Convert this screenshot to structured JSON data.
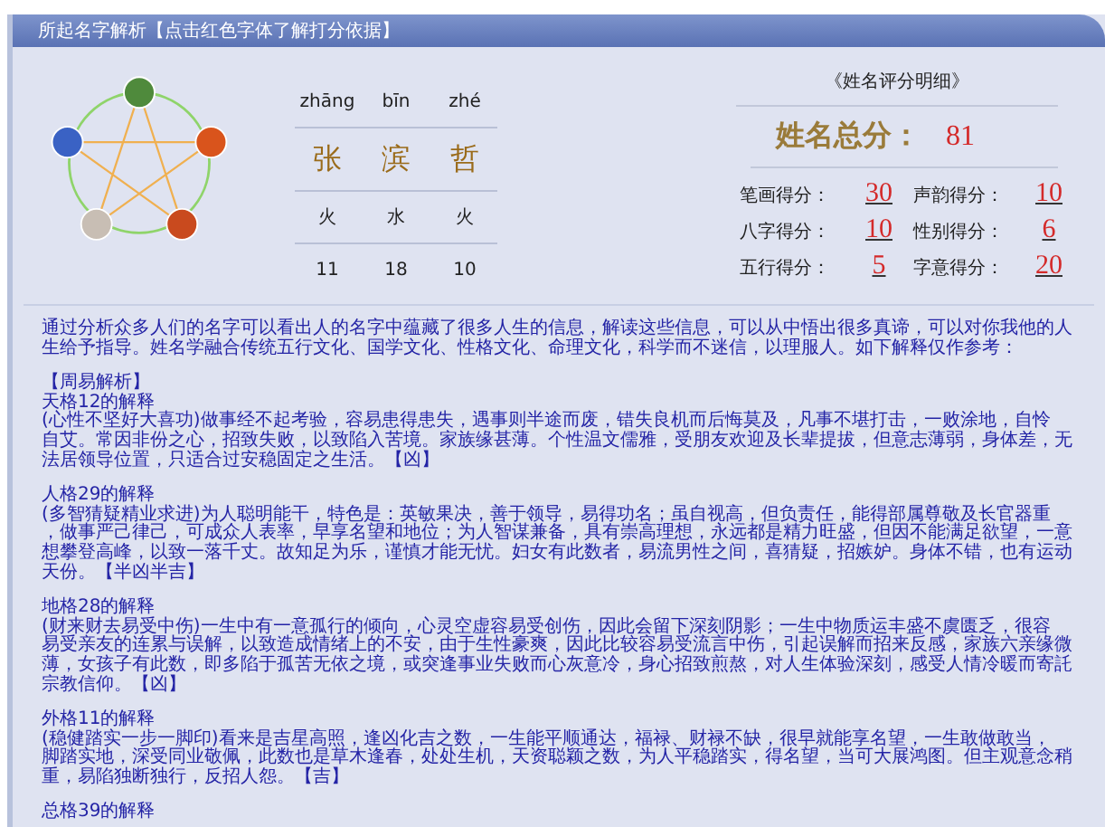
{
  "window": {
    "title": "所起名字解析【点击红色字体了解打分依据】"
  },
  "characters": [
    {
      "pinyin": "zhāng",
      "hanzi": "张",
      "element": "火",
      "strokes": "11"
    },
    {
      "pinyin": "bīn",
      "hanzi": "滨",
      "element": "水",
      "strokes": "18"
    },
    {
      "pinyin": "zhé",
      "hanzi": "哲",
      "element": "火",
      "strokes": "10"
    }
  ],
  "score_panel": {
    "heading": "《姓名评分明细》",
    "total_label": "姓名总分：",
    "total": "81",
    "items": [
      {
        "label": "笔画得分：",
        "value": "30"
      },
      {
        "label": "声韵得分：",
        "value": "10"
      },
      {
        "label": "八字得分：",
        "value": "10"
      },
      {
        "label": "性别得分：",
        "value": "6"
      },
      {
        "label": "五行得分：",
        "value": "5"
      },
      {
        "label": "字意得分：",
        "value": "20"
      }
    ]
  },
  "analysis": {
    "intro": [
      "通过分析众多人们的名字可以看出人的名字中蕴藏了很多人生的信息，解读这些信息，可以从中悟出很多真谛，可以对你我他的人",
      "生给予指导。姓名学融合传统五行文化、国学文化、性格文化、命理文化，科学而不迷信，以理服人。如下解释仅作参考："
    ],
    "section_heading": "【周易解析】",
    "sections": [
      {
        "title": "天格12的解释",
        "lines": [
          "(心性不坚好大喜功)做事经不起考验，容易患得患失，遇事则半途而废，错失良机而后悔莫及，凡事不堪打击，一败涂地，自怜",
          "自艾。常因非份之心，招致失败，以致陷入苦境。家族缘甚薄。个性温文儒雅，受朋友欢迎及长辈提拔，但意志薄弱，身体差，无",
          "法居领导位置，只适合过安稳固定之生活。【凶】"
        ]
      },
      {
        "title": "人格29的解释",
        "lines": [
          "(多智猜疑精业求进)为人聪明能干，特色是：英敏果决，善于领导，易得功名；虽自视高，但负责任，能得部属尊敬及长官器重",
          "，做事严己律己，可成众人表率，早享名望和地位；为人智谋兼备，具有崇高理想，永远都是精力旺盛，但因不能满足欲望，一意",
          "想攀登高峰，以致一落千丈。故知足为乐，谨慎才能无忧。妇女有此数者，易流男性之间，喜猜疑，招嫉妒。身体不错，也有运动",
          "天份。【半凶半吉】"
        ]
      },
      {
        "title": "地格28的解释",
        "lines": [
          "(财来财去易受中伤)一生中有一意孤行的倾向，心灵空虚容易受创伤，因此会留下深刻阴影；一生中物质运丰盛不虞匮乏，很容",
          "易受亲友的连累与误解，以致造成情绪上的不安，由于生性豪爽，因此比较容易受流言中伤，引起误解而招来反感，家族六亲缘微",
          "薄，女孩子有此数，即多陷于孤苦无依之境，或突逢事业失败而心灰意冷，身心招致煎熬，对人生体验深刻，感受人情冷暖而寄託",
          "宗教信仰。【凶】"
        ]
      },
      {
        "title": "外格11的解释",
        "lines": [
          "(稳健踏实一步一脚印)看来是吉星高照，逢凶化吉之数，一生能平顺通达，福禄、财禄不缺，很早就能享名望，一生敢做敢当，",
          "脚踏实地，深受同业敬佩，此数也是草木逢春，处处生机，天资聪颖之数，为人平稳踏实，得名望，当可大展鸿图。但主观意念稍",
          "重，易陷独断独行，反招人怨。【吉】"
        ]
      },
      {
        "title": "总格39的解释"
      }
    ]
  }
}
